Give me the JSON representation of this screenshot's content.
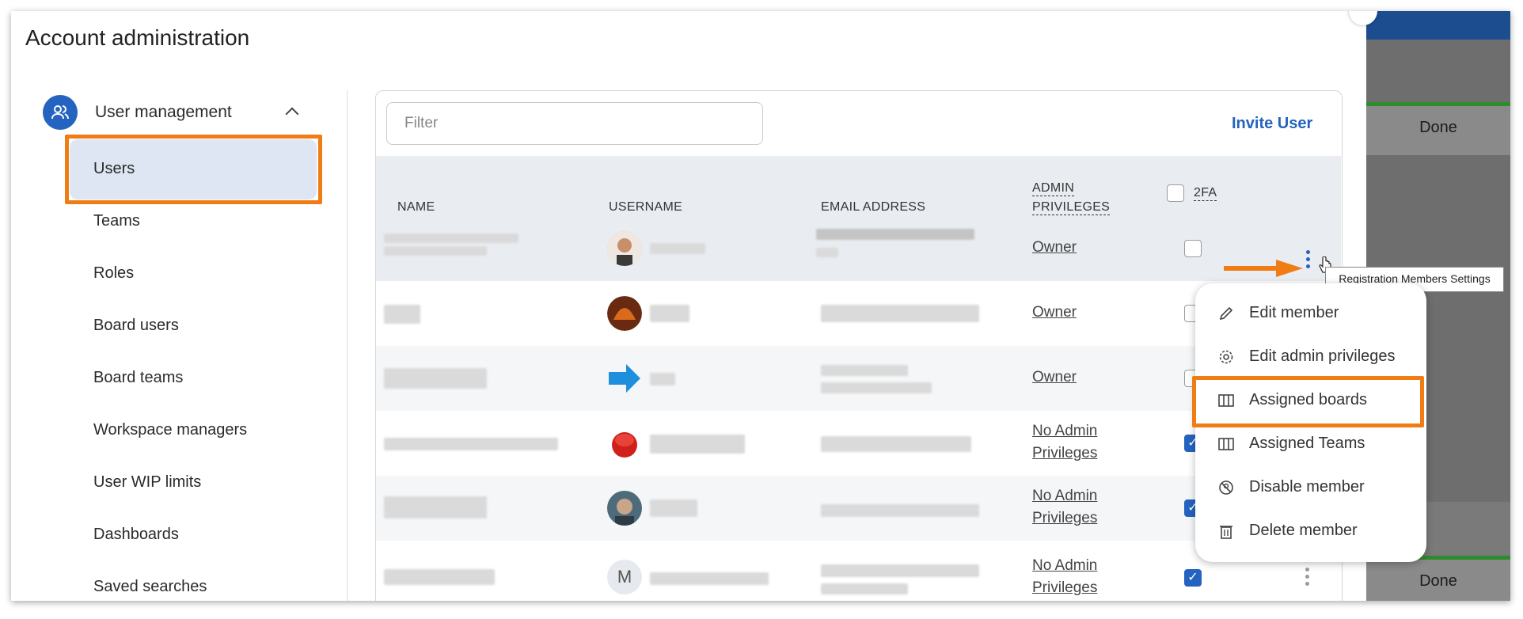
{
  "title": "Account administration",
  "sidebar": {
    "section_label": "User management",
    "items": [
      {
        "label": "Users"
      },
      {
        "label": "Teams"
      },
      {
        "label": "Roles"
      },
      {
        "label": "Board users"
      },
      {
        "label": "Board teams"
      },
      {
        "label": "Workspace managers"
      },
      {
        "label": "User WIP limits"
      },
      {
        "label": "Dashboards"
      },
      {
        "label": "Saved searches"
      }
    ]
  },
  "filter": {
    "placeholder": "Filter"
  },
  "invite_label": "Invite User",
  "table": {
    "headers": {
      "name": "NAME",
      "username": "USERNAME",
      "email": "EMAIL ADDRESS",
      "admin_line1": "ADMIN",
      "admin_line2": "PRIVILEGES",
      "twofa": "2FA"
    },
    "rows": [
      {
        "role": "Owner",
        "twofa_checked": false
      },
      {
        "role": "Owner",
        "twofa_checked": false
      },
      {
        "role": "Owner",
        "twofa_checked": false
      },
      {
        "role_line1": "No Admin",
        "role_line2": "Privileges",
        "twofa_checked": true
      },
      {
        "role_line1": "No Admin",
        "role_line2": "Privileges",
        "twofa_checked": true
      },
      {
        "role_line1": "No Admin",
        "role_line2": "Privileges",
        "twofa_checked": true,
        "avatar_letter": "M"
      }
    ]
  },
  "tooltip": "Registration Members Settings",
  "menu": {
    "items": [
      {
        "label": "Edit member",
        "icon": "pencil-icon"
      },
      {
        "label": "Edit admin privileges",
        "icon": "gear-icon"
      },
      {
        "label": "Assigned boards",
        "icon": "board-icon"
      },
      {
        "label": "Assigned Teams",
        "icon": "board-icon"
      },
      {
        "label": "Disable member",
        "icon": "disable-icon"
      },
      {
        "label": "Delete member",
        "icon": "trash-icon"
      }
    ]
  },
  "background": {
    "done_label": "Done"
  },
  "colors": {
    "accent": "#2563c0",
    "highlight": "#f07c14"
  }
}
